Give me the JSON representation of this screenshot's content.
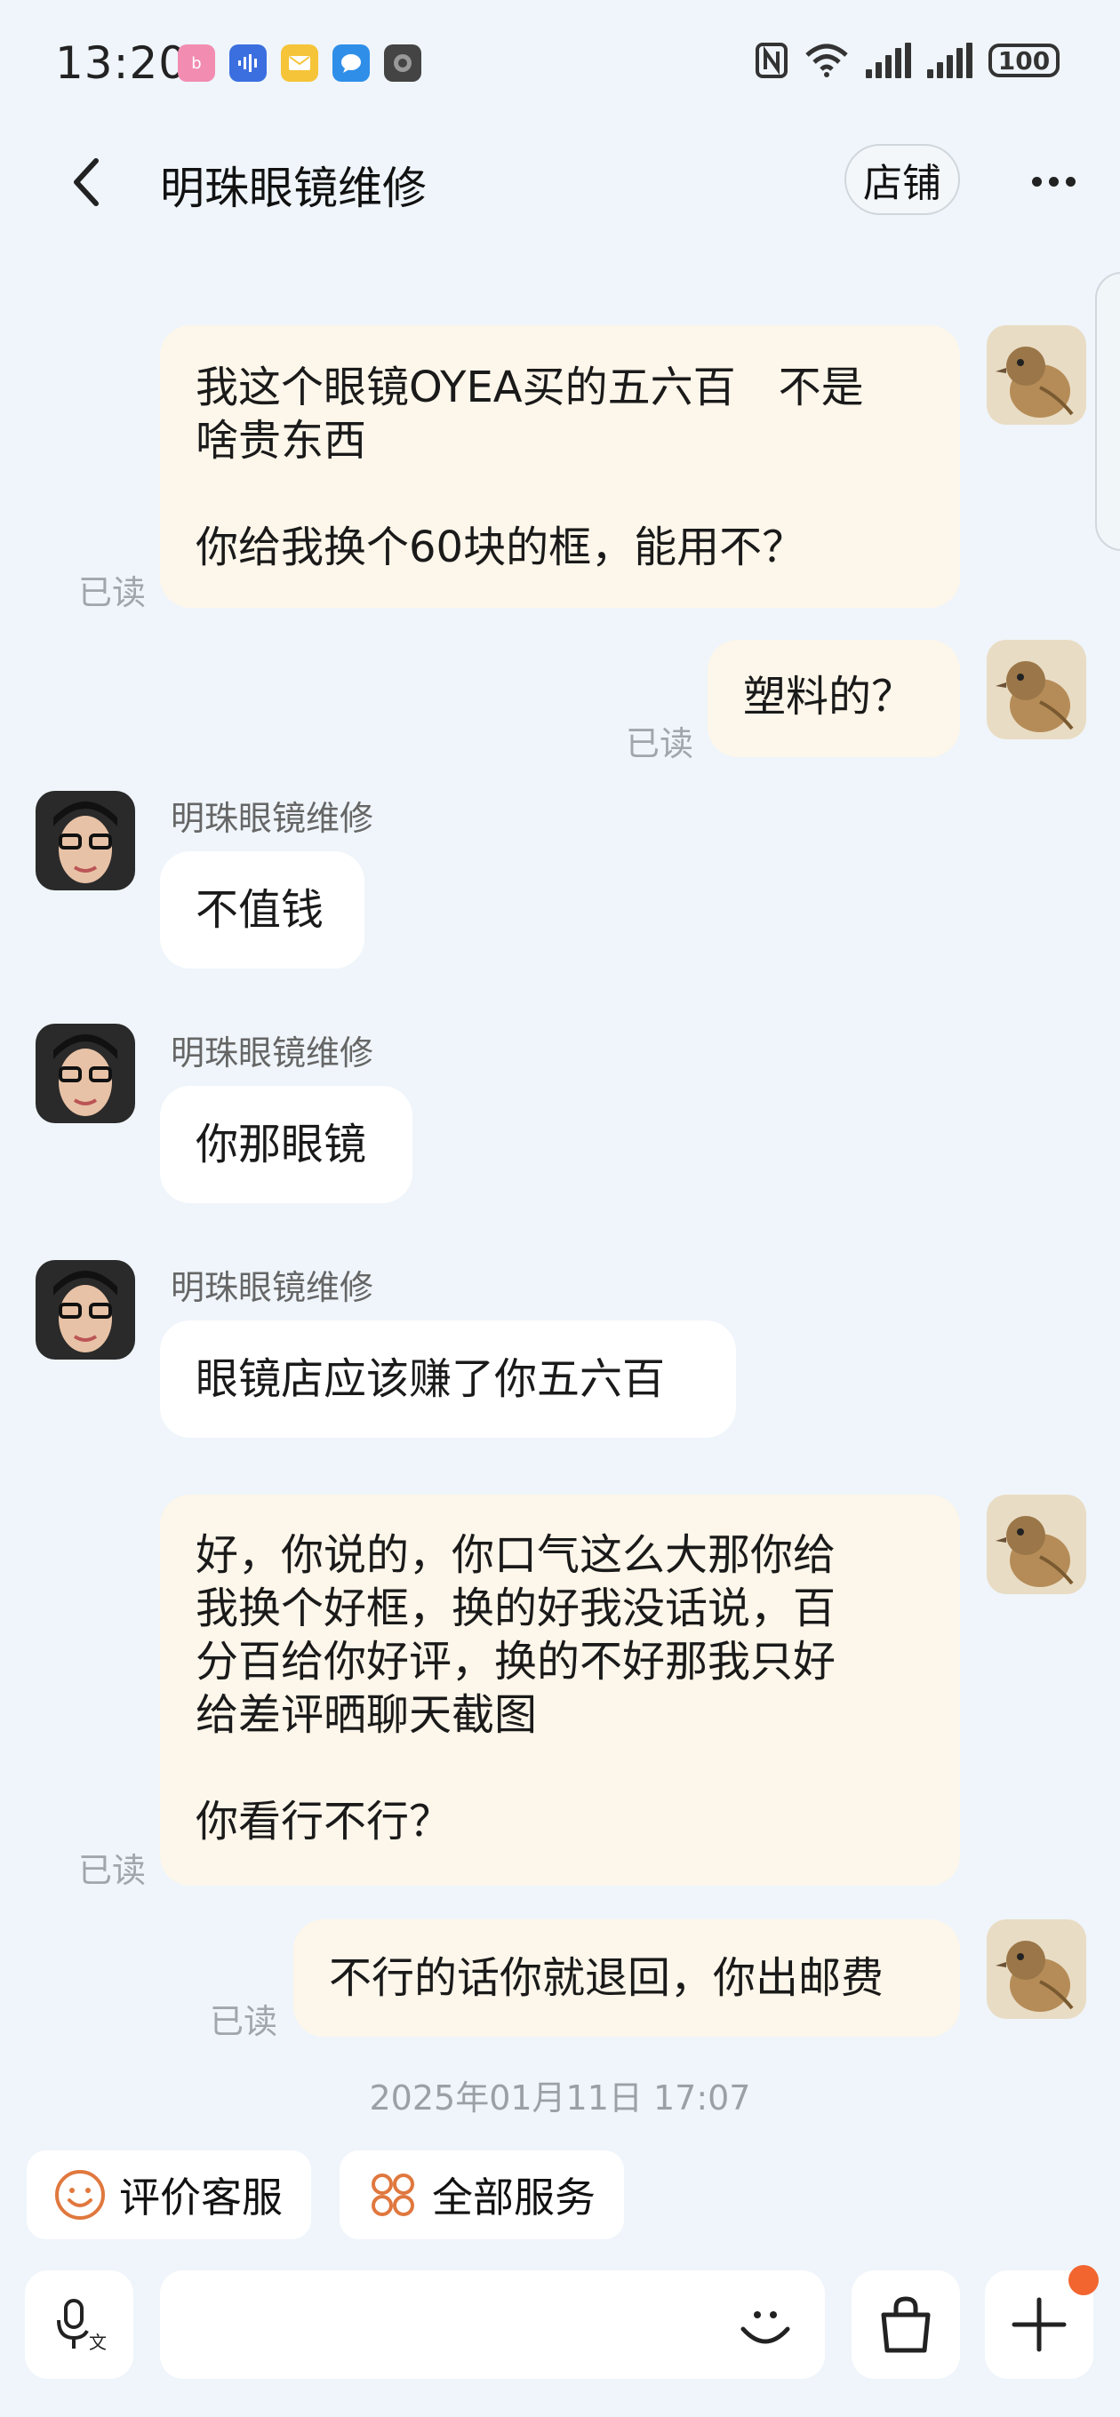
{
  "status_bar": {
    "time": "13:20",
    "battery": "100",
    "notif_icons": [
      "bilibili-icon",
      "voice-recorder-icon",
      "mail-icon",
      "message-icon",
      "app-icon"
    ]
  },
  "header": {
    "title": "明珠眼镜维修",
    "shop_label": "店铺"
  },
  "messages": [
    {
      "dir": "out",
      "text": "我这个眼镜OYEA买的五六百　不是\n啥贵东西\n\n你给我换个60块的框，能用不？",
      "read": "已读"
    },
    {
      "dir": "out",
      "text": "塑料的？",
      "read": "已读"
    },
    {
      "dir": "in",
      "sender": "明珠眼镜维修",
      "text": "不值钱"
    },
    {
      "dir": "in",
      "sender": "明珠眼镜维修",
      "text": "你那眼镜"
    },
    {
      "dir": "in",
      "sender": "明珠眼镜维修",
      "text": "眼镜店应该赚了你五六百"
    },
    {
      "dir": "out",
      "text": "好，你说的，你口气这么大那你给\n我换个好框，换的好我没话说，百\n分百给你好评，换的不好那我只好\n给差评晒聊天截图\n\n你看行不行？",
      "read": "已读"
    },
    {
      "dir": "out",
      "text": "不行的话你就退回，你出邮费",
      "read": "已读"
    }
  ],
  "timestamp": "2025年01月11日 17:07",
  "services": {
    "rate": "评价客服",
    "all": "全部服务"
  },
  "colors": {
    "background": "#eff5fa",
    "out_bubble": "#fdf6ea",
    "in_bubble": "#ffffff",
    "accent": "#e0783e",
    "badge": "#f2652f"
  }
}
